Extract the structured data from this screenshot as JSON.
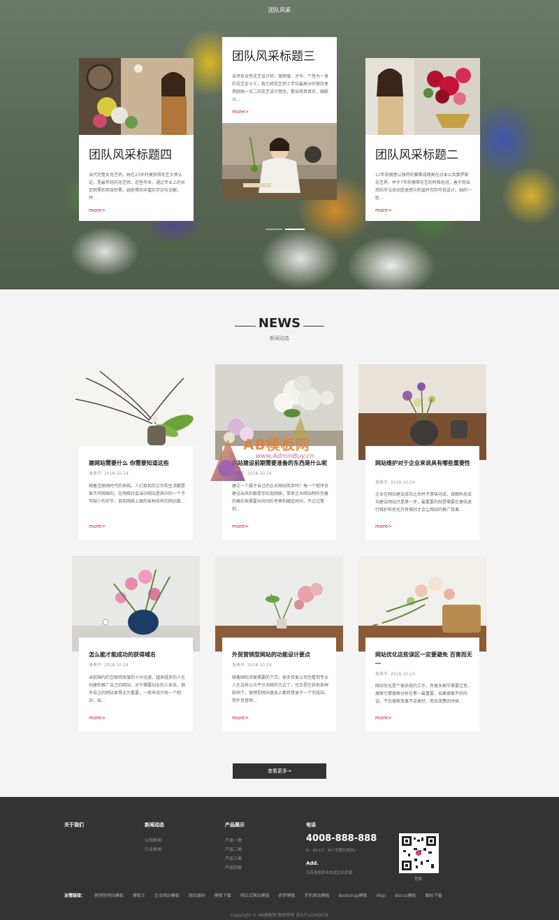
{
  "hero": {
    "subtitle": "团队风采",
    "cards": [
      {
        "title": "团队风采标题四",
        "desc": "当代完整女花艺师，她在23岁时便获得花艺大师认证，是最年轻的花艺师。近些年来，通过专业上的长足积累和项目积累，她获得到丰富的学识与见解，并...",
        "more": "more>"
      },
      {
        "title": "团队风采标题三",
        "desc": "自然系女性花艺设计师，美颜值、才华、个性为一身的花艺女斗士，致力将花艺师士学位最高分的保持者用她独一无二的花艺设计理念，看似简单真实，细腻以...",
        "more": "more>"
      },
      {
        "title": "团队风采标题二",
        "desc": "12年前随意以独特的赛事成绩高在日本以及俄罗斯花艺界，并于7年前摘得花艺的特殊桂冠，善于用自然的手法去创造美感与和谐并存的可视设计。她的一些...",
        "more": "more>"
      }
    ]
  },
  "news": {
    "title": "NEWS",
    "subtitle": "新闻动态",
    "items": [
      {
        "title": "建网站需要什么 你需要知道这些",
        "date": "发表于: 2018-10-24",
        "desc": "随着互联网时代的来临，人们目前的工作和生活都是离不开网络的。在网络社会当中网站是其中的一个不可缺少的环节，目前网络上面的各种各样的网站数...",
        "more": "more>"
      },
      {
        "title": "网站建设前期需要准备的东西是什么呢",
        "date": "发表于: 2018-10-24",
        "desc": "建立一个属于自己的企业网站简单吗？每一个程序员建设出来的都是你实现网络，单单企业网站制作完善的确实就需要长时间的考察和确定时间，不过过策划...",
        "more": "more>"
      },
      {
        "title": "网站维护对于企业来说具有哪些重要性",
        "date": "发表于: 2018-10-24",
        "desc": "企业在网站建设成功之后并不意味功成，接触科技成功建设网站只是第一步，最重要的就是需要在建站进行维护和优化只有做好才会让网站的推广效果...",
        "more": "more>"
      },
      {
        "title": "怎么能才能成功的获得域名",
        "date": "发表于: 2018-10-24",
        "desc": "当前国内的互联网发展的十分迅速，越来越多的人在创建和推广自己的网站，对于需要创业的人来说，拥有自己的网站显得尤为重要，一般来说只有一个网站，如...",
        "more": "more>"
      },
      {
        "title": "外贸营销型网站的功能设计要点",
        "date": "发表于: 2018-10-24",
        "desc": "随着国际贸易需要的下沉，很多贸易公司也看到专业人在这样公众平台消耗的方式了，也正是在其他各种影响下，营销型网站基本上都将登录于一个完成站，而外贸营销...",
        "more": "more>"
      },
      {
        "title": "网站优化这些误区一定要避免 百害而无一",
        "date": "发表于: 2018-10-24",
        "desc": "网站优化是个很系统的工作，有很多细节需要注意，搜索引擎搜索分析在第一最重要，如果搜索不好的话，不仅搜索效果不会更好，而且浪费的时候...",
        "more": "more>"
      }
    ],
    "more_button": "查看更多→"
  },
  "footer": {
    "about": {
      "title": "关于我们"
    },
    "news": {
      "title": "新闻动态",
      "links": [
        "公司新闻",
        "行业新闻"
      ]
    },
    "products": {
      "title": "产品展示",
      "links": [
        "产品一类",
        "产品二类",
        "产品三类",
        "产品四类"
      ]
    },
    "contact": {
      "title": "电话",
      "phone": "4008-888-888",
      "hours": "8：30-17：30 (节假日除外)",
      "addr_label": "Add.",
      "addr": "江苏省南京市玄武区玄武湖"
    },
    "qr_label": "官微",
    "friend_label": "友情链接：",
    "friends": [
      "营销型网站模板",
      "模板王",
      "企业网站模板",
      "网站源码",
      "模板下载",
      "响应式网站模板",
      "织梦模板",
      "手机网站模板",
      "Bootstrap模板",
      "Wap",
      "discuz模板",
      "图标下载"
    ],
    "copyright": "Copyright © AB模板网 版权所有 苏ICP12345678"
  },
  "watermark": {
    "brand": "AB模板网",
    "url": "www.AdminBuy.cn"
  }
}
